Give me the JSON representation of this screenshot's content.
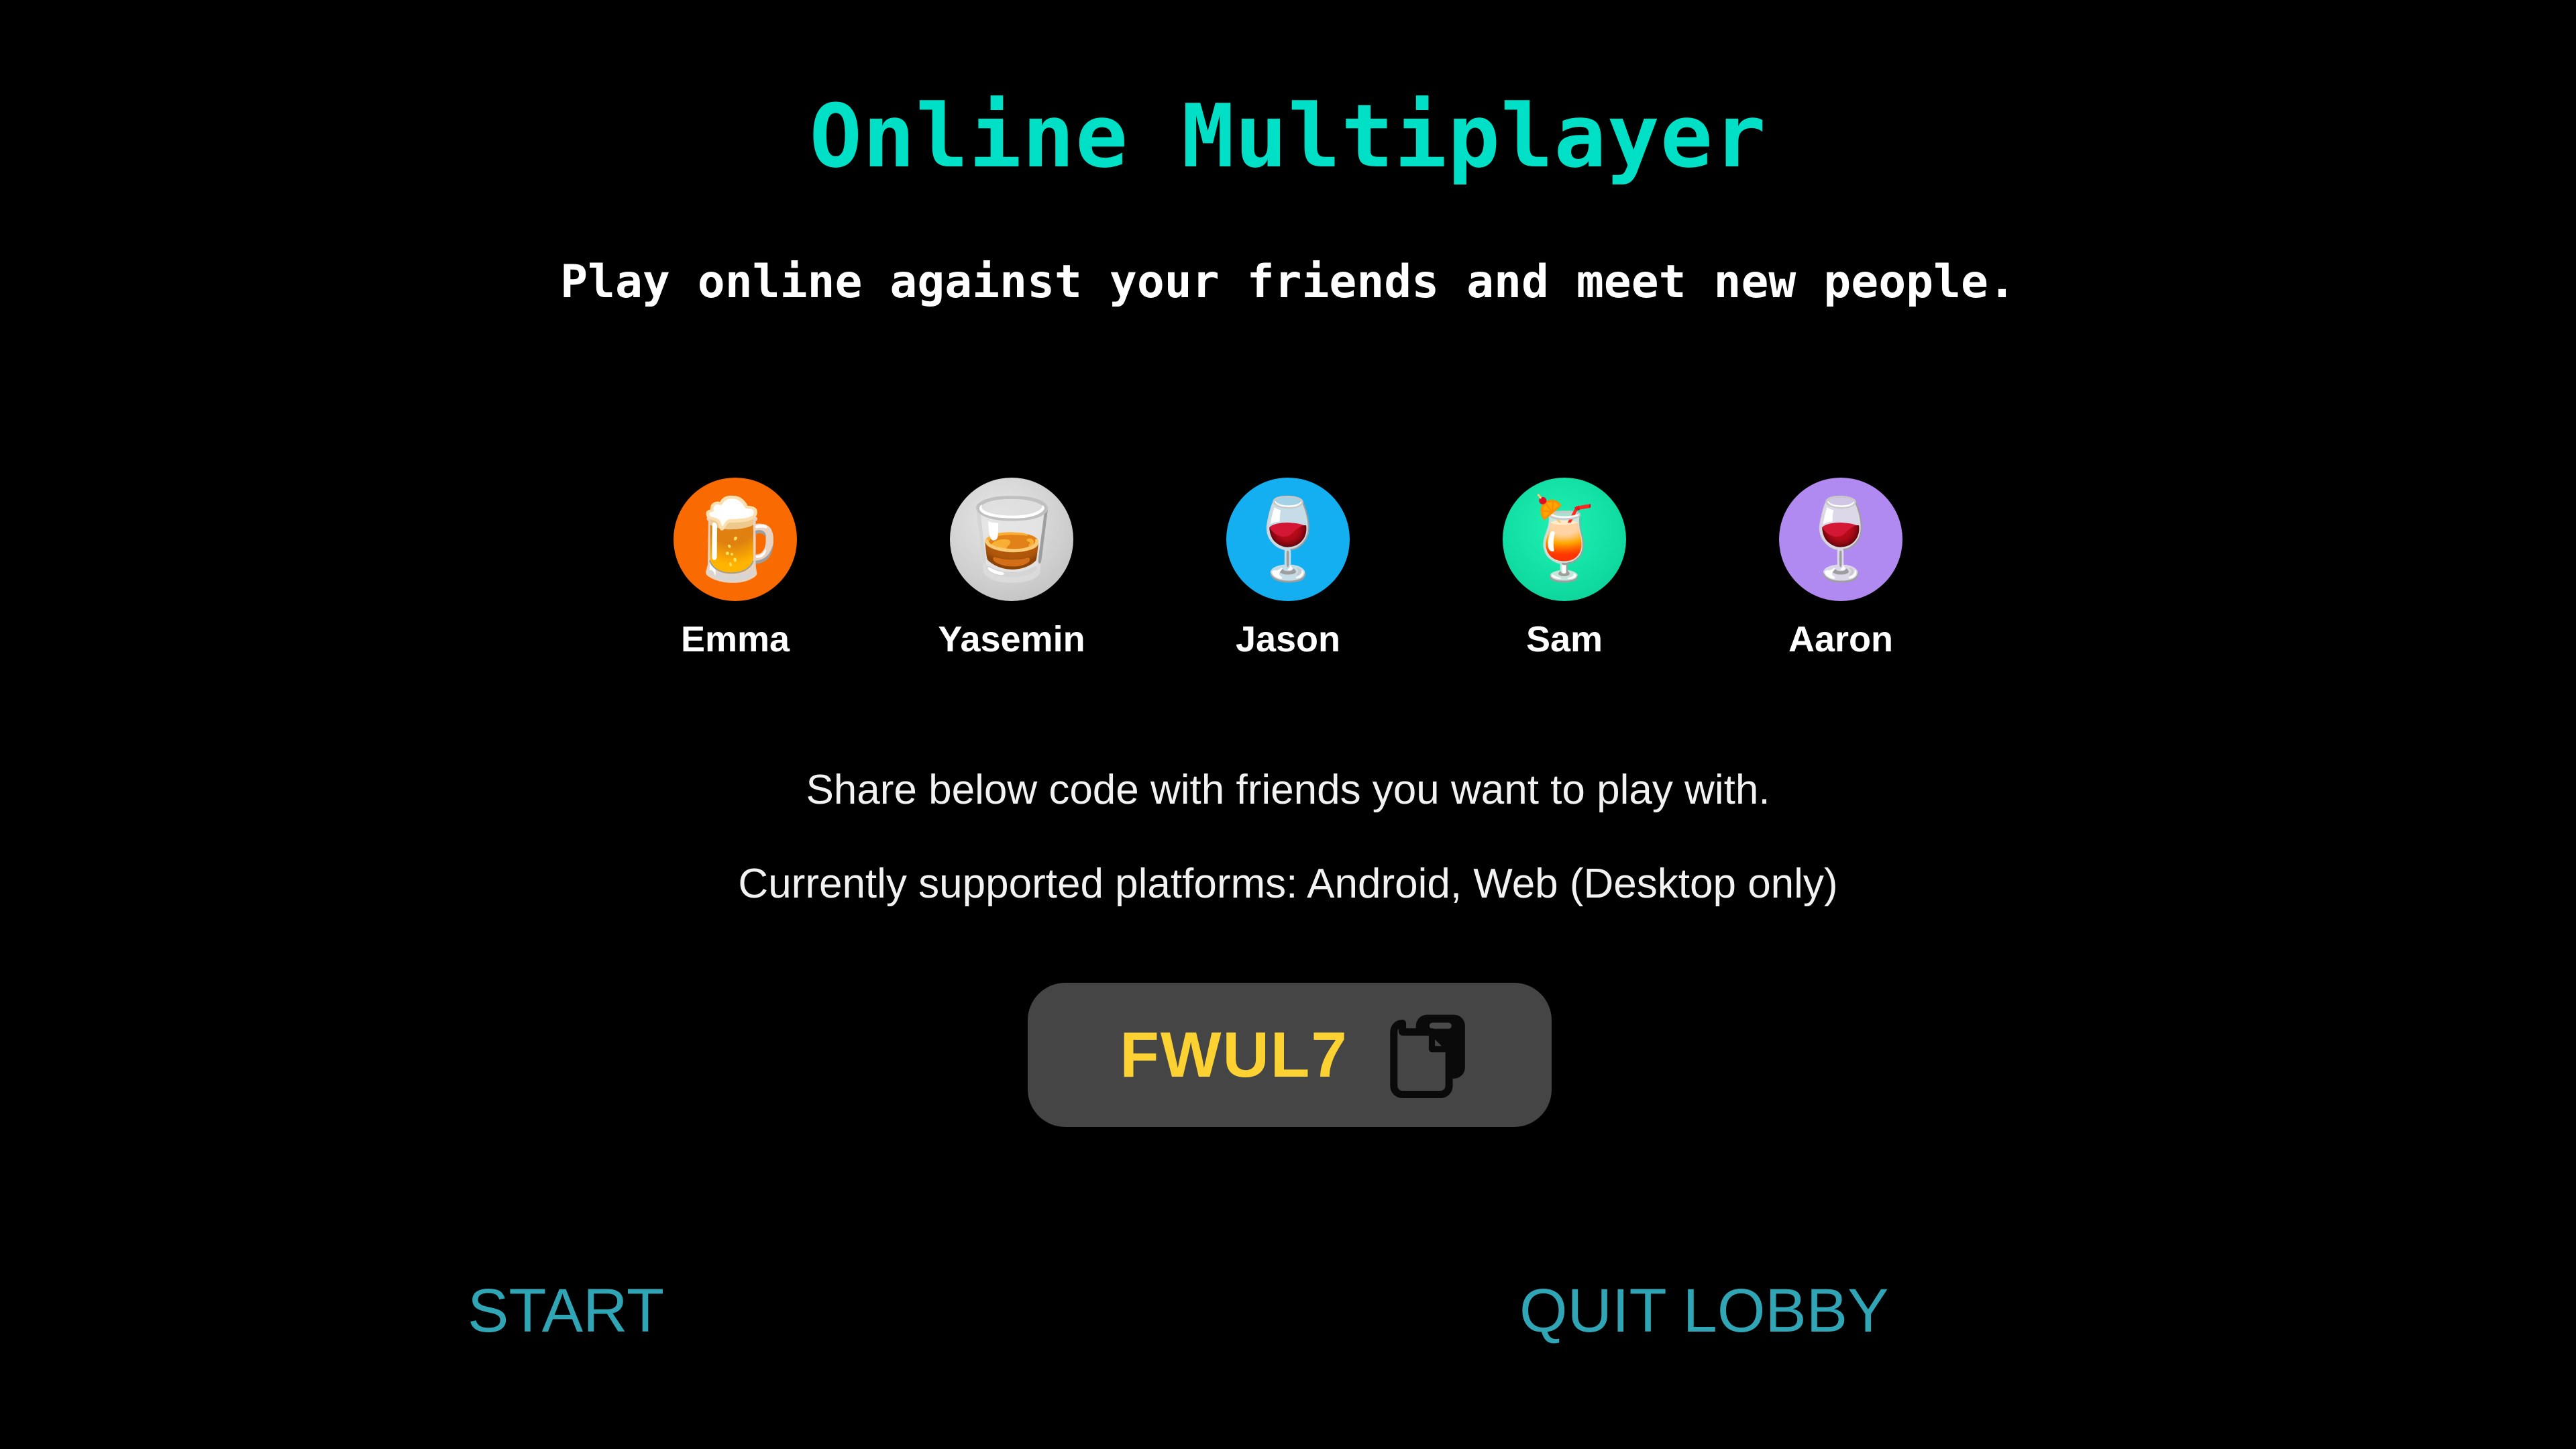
{
  "screen": {
    "background_color": "#000000",
    "title": "Online Multiplayer",
    "subtitle": "Play online against your friends and meet new people."
  },
  "theme": {
    "title_color": "#00E0C6",
    "subtitle_color": "#FFFFFF",
    "info_color": "#F2F2F2",
    "action_color": "#2FA5B5",
    "pill_background": "#454545",
    "code_color": "#FBD231"
  },
  "players": [
    {
      "name": "Emma",
      "avatar_icon": "beer-mug-icon",
      "emoji": "🍺",
      "avatar_color": "#F96A00"
    },
    {
      "name": "Yasemin",
      "avatar_icon": "whiskey-tumbler-icon",
      "emoji": "🥃",
      "avatar_color": "#CCCCCC"
    },
    {
      "name": "Jason",
      "avatar_icon": "red-wine-glass-icon",
      "emoji": "🍷",
      "avatar_color": "#14AFF1"
    },
    {
      "name": "Sam",
      "avatar_icon": "tropical-drink-icon",
      "emoji": "🍹",
      "avatar_color": "#14E0A5"
    },
    {
      "name": "Aaron",
      "avatar_icon": "rose-wine-glass-icon",
      "emoji": "🍷",
      "avatar_color": "#B08AF0"
    }
  ],
  "info": {
    "share_line": "Share below code with friends you want to play with.",
    "platforms_line": "Currently supported platforms: Android, Web (Desktop only)"
  },
  "lobby_code": {
    "code": "FWUL7",
    "copy_icon": "copy-icon"
  },
  "actions": {
    "start_label": "START",
    "quit_label": "QUIT LOBBY"
  }
}
